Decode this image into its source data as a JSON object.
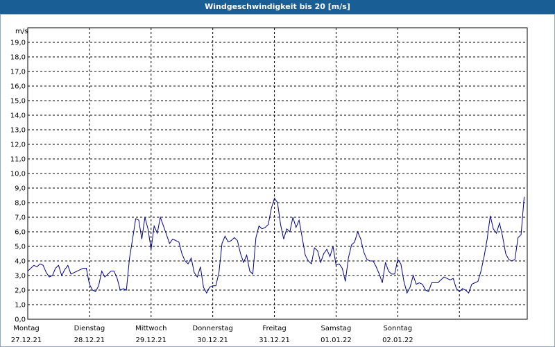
{
  "window": {
    "title": "Windgeschwindigkeit bis 20 [m/s]"
  },
  "chart_data": {
    "type": "line",
    "title": "Windgeschwindigkeit bis 20 [m/s]",
    "ylabel": "m/s",
    "xlabel": "",
    "ylim": [
      0,
      20
    ],
    "y_ticks": [
      "0,0",
      "1,0",
      "2,0",
      "3,0",
      "4,0",
      "5,0",
      "6,0",
      "7,0",
      "8,0",
      "9,0",
      "10,0",
      "11,0",
      "12,0",
      "13,0",
      "14,0",
      "15,0",
      "16,0",
      "17,0",
      "18,0",
      "19,0"
    ],
    "x_ticks": [
      {
        "day": "Montag",
        "date": "27.12.21"
      },
      {
        "day": "Dienstag",
        "date": "28.12.21"
      },
      {
        "day": "Mittwoch",
        "date": "29.12.21"
      },
      {
        "day": "Donnerstag",
        "date": "30.12.21"
      },
      {
        "day": "Freitag",
        "date": "31.12.21"
      },
      {
        "day": "Samstag",
        "date": "01.01.22"
      },
      {
        "day": "Sonntag",
        "date": "02.01.22"
      }
    ],
    "grid": true,
    "line_color": "#00008b",
    "series": [
      {
        "points": [
          [
            0,
            3.3
          ],
          [
            0.05,
            3.5
          ],
          [
            0.1,
            3.7
          ],
          [
            0.15,
            3.6
          ],
          [
            0.2,
            3.8
          ],
          [
            0.25,
            3.7
          ],
          [
            0.3,
            3.2
          ],
          [
            0.35,
            2.9
          ],
          [
            0.4,
            3.0
          ],
          [
            0.45,
            3.5
          ],
          [
            0.5,
            3.7
          ],
          [
            0.55,
            3.0
          ],
          [
            0.6,
            3.4
          ],
          [
            0.65,
            3.7
          ],
          [
            0.7,
            3.1
          ],
          [
            0.75,
            3.2
          ],
          [
            0.8,
            3.3
          ],
          [
            0.85,
            3.4
          ],
          [
            0.9,
            3.5
          ],
          [
            0.95,
            3.5
          ],
          [
            1.0,
            2.4
          ],
          [
            1.05,
            2.0
          ],
          [
            1.1,
            1.9
          ],
          [
            1.15,
            2.3
          ],
          [
            1.2,
            3.3
          ],
          [
            1.25,
            2.9
          ],
          [
            1.3,
            3.1
          ],
          [
            1.35,
            3.3
          ],
          [
            1.4,
            3.3
          ],
          [
            1.45,
            2.8
          ],
          [
            1.5,
            2.0
          ],
          [
            1.55,
            2.1
          ],
          [
            1.6,
            2.0
          ],
          [
            1.65,
            4.2
          ],
          [
            1.7,
            5.5
          ],
          [
            1.75,
            6.9
          ],
          [
            1.8,
            6.8
          ],
          [
            1.85,
            5.5
          ],
          [
            1.9,
            7.0
          ],
          [
            1.95,
            6.2
          ],
          [
            2.0,
            4.8
          ],
          [
            2.05,
            6.4
          ],
          [
            2.1,
            5.9
          ],
          [
            2.15,
            7.0
          ],
          [
            2.2,
            6.4
          ],
          [
            2.25,
            5.8
          ],
          [
            2.3,
            5.2
          ],
          [
            2.35,
            5.5
          ],
          [
            2.4,
            5.4
          ],
          [
            2.45,
            5.3
          ],
          [
            2.5,
            4.5
          ],
          [
            2.55,
            4.0
          ],
          [
            2.6,
            3.8
          ],
          [
            2.65,
            4.2
          ],
          [
            2.7,
            3.2
          ],
          [
            2.75,
            2.9
          ],
          [
            2.8,
            3.6
          ],
          [
            2.85,
            2.2
          ],
          [
            2.9,
            1.8
          ],
          [
            2.95,
            2.2
          ],
          [
            3.0,
            2.3
          ],
          [
            3.05,
            2.3
          ],
          [
            3.1,
            3.2
          ],
          [
            3.15,
            5.2
          ],
          [
            3.2,
            5.7
          ],
          [
            3.25,
            5.3
          ],
          [
            3.3,
            5.4
          ],
          [
            3.35,
            5.6
          ],
          [
            3.4,
            5.4
          ],
          [
            3.45,
            4.5
          ],
          [
            3.5,
            3.9
          ],
          [
            3.55,
            4.4
          ],
          [
            3.6,
            3.3
          ],
          [
            3.65,
            3.1
          ],
          [
            3.7,
            5.6
          ],
          [
            3.75,
            6.4
          ],
          [
            3.8,
            6.2
          ],
          [
            3.85,
            6.3
          ],
          [
            3.9,
            6.5
          ],
          [
            3.95,
            7.6
          ],
          [
            4.0,
            8.3
          ],
          [
            4.05,
            8.0
          ],
          [
            4.1,
            6.5
          ],
          [
            4.15,
            5.5
          ],
          [
            4.2,
            6.2
          ],
          [
            4.25,
            6.0
          ],
          [
            4.3,
            7.0
          ],
          [
            4.35,
            6.3
          ],
          [
            4.4,
            6.8
          ],
          [
            4.45,
            5.6
          ],
          [
            4.5,
            4.4
          ],
          [
            4.55,
            4.0
          ],
          [
            4.6,
            3.8
          ],
          [
            4.65,
            4.9
          ],
          [
            4.7,
            4.7
          ],
          [
            4.75,
            3.9
          ],
          [
            4.8,
            4.5
          ],
          [
            4.85,
            4.8
          ],
          [
            4.9,
            4.3
          ],
          [
            4.95,
            5.0
          ],
          [
            5.0,
            3.7
          ],
          [
            5.05,
            3.8
          ],
          [
            5.1,
            3.5
          ],
          [
            5.15,
            2.6
          ],
          [
            5.2,
            4.2
          ],
          [
            5.25,
            5.1
          ],
          [
            5.3,
            5.3
          ],
          [
            5.35,
            6.0
          ],
          [
            5.4,
            5.5
          ],
          [
            5.45,
            4.6
          ],
          [
            5.5,
            4.1
          ],
          [
            5.55,
            4.0
          ],
          [
            5.6,
            4.0
          ],
          [
            5.65,
            3.6
          ],
          [
            5.7,
            3.1
          ],
          [
            5.75,
            2.5
          ],
          [
            5.8,
            3.9
          ],
          [
            5.85,
            3.3
          ],
          [
            5.9,
            3.1
          ],
          [
            5.95,
            3.1
          ],
          [
            6.0,
            4.1
          ],
          [
            6.05,
            3.8
          ],
          [
            6.1,
            2.6
          ],
          [
            6.15,
            1.8
          ],
          [
            6.2,
            2.2
          ],
          [
            6.25,
            3.0
          ],
          [
            6.3,
            2.4
          ],
          [
            6.35,
            2.5
          ],
          [
            6.4,
            2.4
          ],
          [
            6.45,
            2.0
          ],
          [
            6.5,
            1.9
          ],
          [
            6.55,
            2.5
          ],
          [
            6.6,
            2.5
          ],
          [
            6.65,
            2.5
          ],
          [
            6.7,
            2.7
          ],
          [
            6.75,
            2.9
          ],
          [
            6.8,
            2.8
          ],
          [
            6.85,
            2.7
          ],
          [
            6.9,
            2.8
          ],
          [
            6.95,
            2.1
          ],
          [
            7.0,
            1.9
          ],
          [
            7.05,
            2.1
          ],
          [
            7.1,
            2.0
          ],
          [
            7.15,
            1.8
          ],
          [
            7.2,
            2.4
          ],
          [
            7.25,
            2.5
          ],
          [
            7.3,
            2.6
          ],
          [
            7.35,
            3.3
          ],
          [
            7.4,
            4.3
          ],
          [
            7.45,
            5.5
          ],
          [
            7.5,
            7.1
          ],
          [
            7.55,
            6.2
          ],
          [
            7.6,
            5.9
          ],
          [
            7.65,
            6.6
          ],
          [
            7.7,
            5.7
          ],
          [
            7.75,
            4.5
          ],
          [
            7.8,
            4.1
          ],
          [
            7.85,
            4.0
          ],
          [
            7.9,
            4.1
          ],
          [
            7.95,
            5.6
          ],
          [
            8.0,
            5.8
          ],
          [
            8.05,
            8.4
          ]
        ]
      }
    ]
  }
}
